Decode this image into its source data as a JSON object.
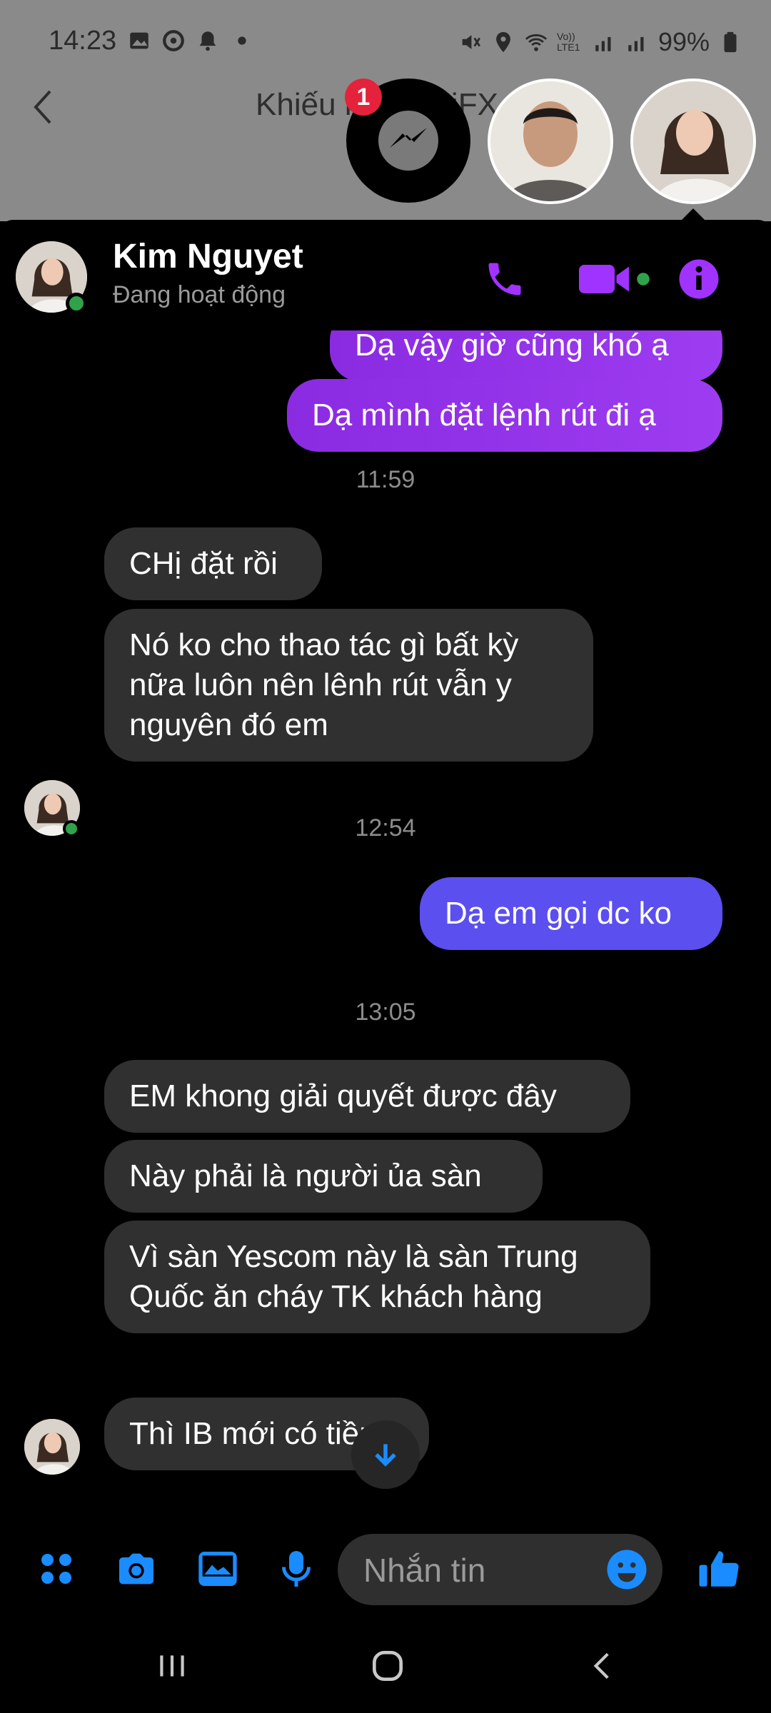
{
  "status_bar": {
    "time": "14:23",
    "battery": "99%",
    "volte": "Vo)) LTE1"
  },
  "underlay": {
    "title": "Khiếu nại TickiFX"
  },
  "chat_heads": {
    "unread_badge": "1"
  },
  "chat": {
    "contact_name": "Kim Nguyet",
    "contact_status": "Đang hoạt động"
  },
  "messages": [
    {
      "type": "out",
      "text": "Dạ vậy giờ cũng khó ạ"
    },
    {
      "type": "out",
      "text": "Dạ mình đặt lệnh rút đi ạ"
    },
    {
      "type": "time",
      "text": "11:59"
    },
    {
      "type": "in",
      "text": "CHị đặt rồi"
    },
    {
      "type": "in",
      "text": "Nó ko cho thao tác gì bất kỳ nữa luôn nên lênh rút vẫn y nguyên đó em"
    },
    {
      "type": "time",
      "text": "12:54"
    },
    {
      "type": "out",
      "text": "Dạ em gọi dc ko"
    },
    {
      "type": "time",
      "text": "13:05"
    },
    {
      "type": "in",
      "text": "EM khong giải quyết được đây"
    },
    {
      "type": "in",
      "text": "Này phải là người ủa sàn"
    },
    {
      "type": "in",
      "text": "Vì sàn Yescom này là sàn Trung Quốc ăn cháy TK khách hàng"
    },
    {
      "type": "in",
      "text": "Thì IB mới có tiền"
    }
  ],
  "composer": {
    "placeholder": "Nhắn tin"
  },
  "colors": {
    "accent_purple": "#9d3cf0",
    "accent_blue": "#1a8cff",
    "online_green": "#31a24c",
    "badge_red": "#e4223b"
  },
  "icons": [
    "phone-icon",
    "video-icon",
    "info-icon",
    "menu-grid-icon",
    "camera-icon",
    "gallery-icon",
    "microphone-icon",
    "emoji-icon",
    "thumbs-up-icon",
    "scroll-down-icon"
  ]
}
